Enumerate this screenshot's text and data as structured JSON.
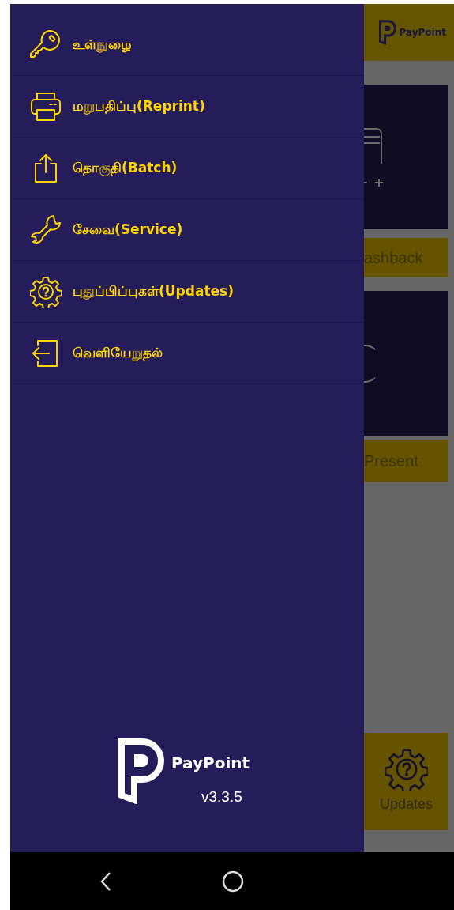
{
  "drawer": {
    "items": [
      {
        "kind": "key",
        "label": "உள்நுழை"
      },
      {
        "kind": "printer",
        "label": "மறுபதிப்பு(Reprint)"
      },
      {
        "kind": "upload",
        "label": "தொகுதி(Batch)"
      },
      {
        "kind": "wrench",
        "label": "சேவை(Service)"
      },
      {
        "kind": "gear",
        "label": "புதுப்பிப்புகள்(Updates)"
      },
      {
        "kind": "exit",
        "label": "வெளியேறுதல்"
      }
    ],
    "logo_text": "PayPoint",
    "version": "v3.3.5"
  },
  "background": {
    "top_bar": {
      "logo_text": "PayPoint"
    },
    "cards": [
      {
        "label": "ashback"
      },
      {
        "label": "Present"
      }
    ],
    "updates_button": {
      "label": "Updates"
    }
  }
}
